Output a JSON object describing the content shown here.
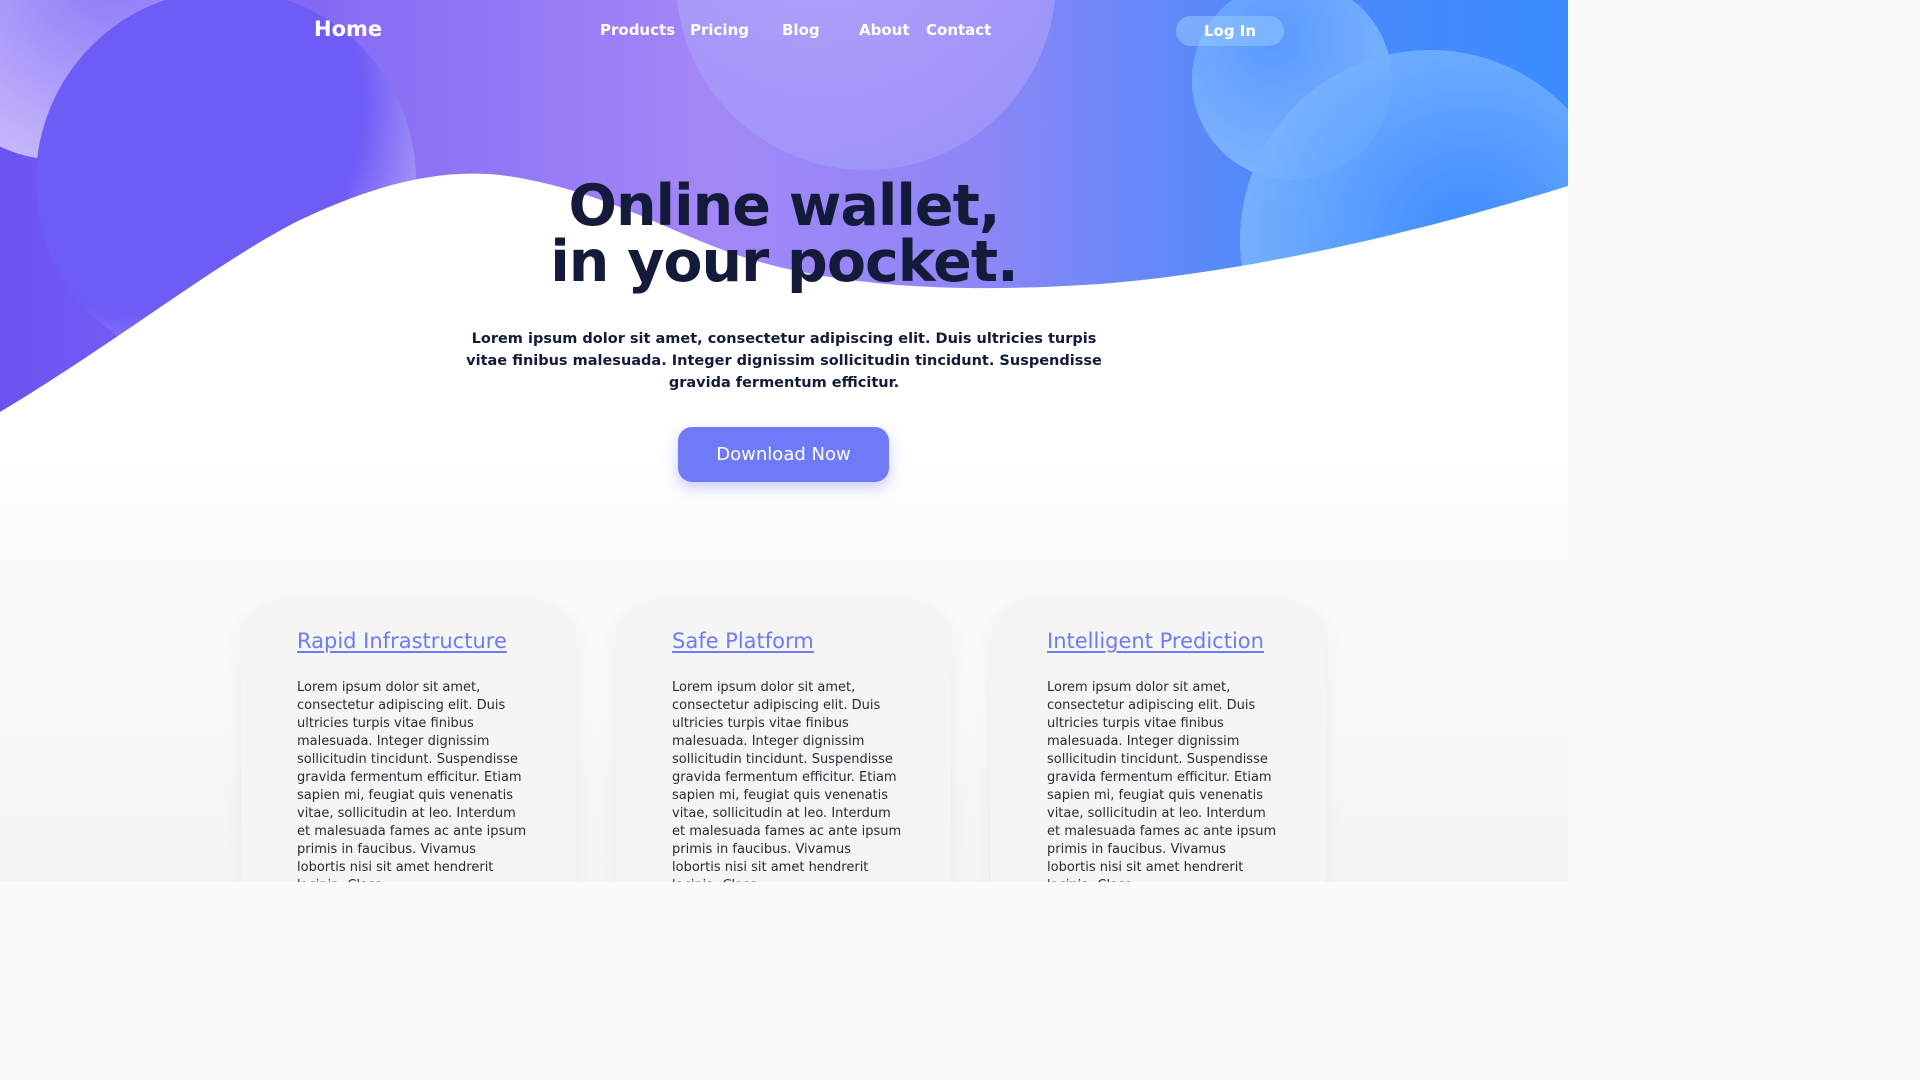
{
  "nav": {
    "brand": "Home",
    "links": [
      "Products",
      "Pricing",
      "Blog",
      "About",
      "Contact"
    ],
    "login_label": "Log In"
  },
  "hero": {
    "headline_line1": "Online wallet,",
    "headline_line2": "in your pocket.",
    "subtitle": "Lorem ipsum dolor sit amet, consectetur adipiscing elit. Duis ultricies turpis vitae finibus malesuada. Integer dignissim sollicitudin tincidunt. Suspendisse gravida fermentum efficitur.",
    "cta_label": "Download Now"
  },
  "features": [
    {
      "title": "Rapid Infrastructure",
      "body": "Lorem ipsum dolor sit amet, consectetur adipiscing elit. Duis ultricies turpis vitae finibus malesuada. Integer dignissim sollicitudin tincidunt. Suspendisse gravida fermentum efficitur. Etiam sapien mi, feugiat quis venenatis vitae, sollicitudin at leo. Interdum et malesuada fames ac ante ipsum primis in faucibus. Vivamus lobortis nisi sit amet hendrerit lacinia. Class"
    },
    {
      "title": "Safe Platform",
      "body": "Lorem ipsum dolor sit amet, consectetur adipiscing elit. Duis ultricies turpis vitae finibus malesuada. Integer dignissim sollicitudin tincidunt. Suspendisse gravida fermentum efficitur. Etiam sapien mi, feugiat quis venenatis vitae, sollicitudin at leo. Interdum et malesuada fames ac ante ipsum primis in faucibus. Vivamus lobortis nisi sit amet hendrerit lacinia. Class"
    },
    {
      "title": "Intelligent Prediction",
      "body": "Lorem ipsum dolor sit amet, consectetur adipiscing elit. Duis ultricies turpis vitae finibus malesuada. Integer dignissim sollicitudin tincidunt. Suspendisse gravida fermentum efficitur. Etiam sapien mi, feugiat quis venenatis vitae, sollicitudin at leo. Interdum et malesuada fames ac ante ipsum primis in faucibus. Vivamus lobortis nisi sit amet hendrerit lacinia. Class"
    }
  ],
  "colors": {
    "accent": "#6f7af9",
    "heading": "#141a3a",
    "hero_purple": "#6a55f0",
    "hero_blue": "#3f8cff"
  }
}
